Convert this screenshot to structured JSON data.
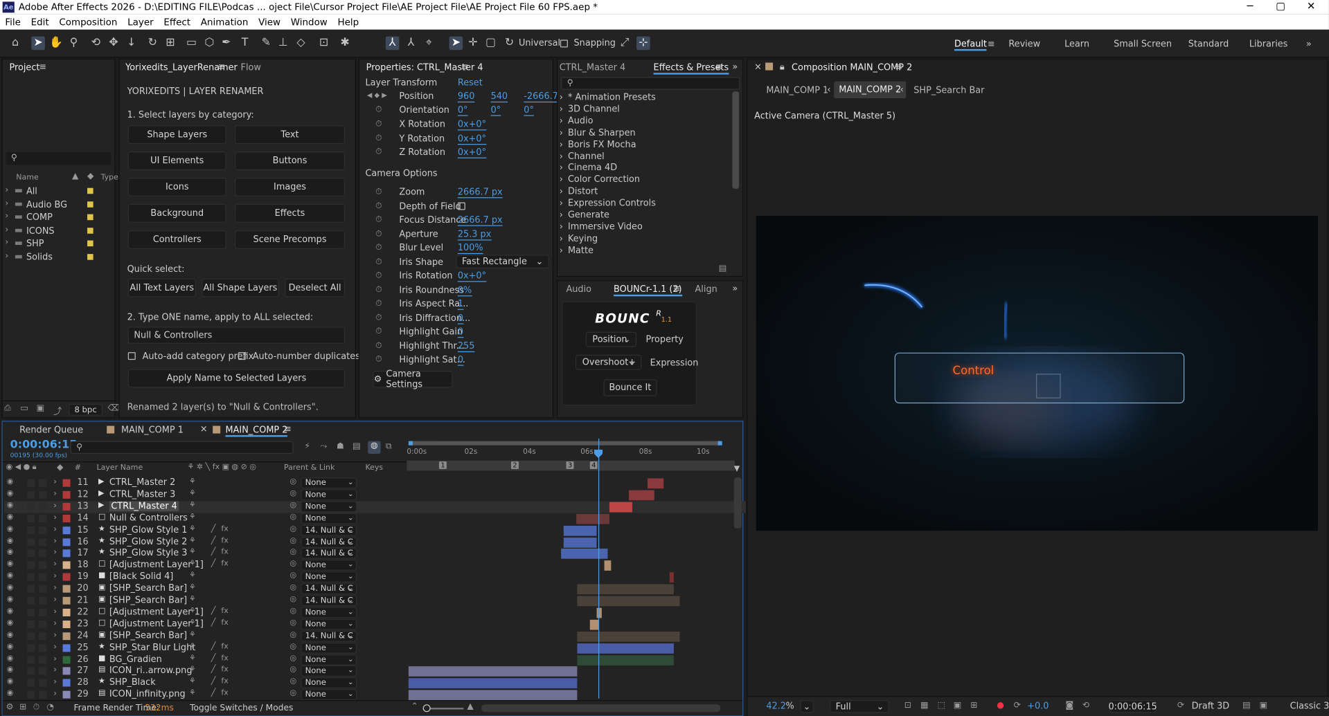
{
  "window": {
    "title": "Adobe After Effects 2026 - D:\\EDITING FILE\\Podcas ... oject File\\Cursor Project File\\AE Project File\\AE Project File 60 FPS.aep *",
    "app_badge": "Ae",
    "minimize": "─",
    "maximize": "▢",
    "close": "✕"
  },
  "menu": [
    "File",
    "Edit",
    "Composition",
    "Layer",
    "Effect",
    "Animation",
    "View",
    "Window",
    "Help"
  ],
  "toolbar": {
    "universal": "Universal",
    "snapping": "Snapping"
  },
  "workspaces": [
    "Default",
    "Review",
    "Learn",
    "Small Screen",
    "Standard",
    "Libraries"
  ],
  "project": {
    "tab": "Project",
    "columns": {
      "name": "Name",
      "type": "Type"
    },
    "items": [
      {
        "name": "All",
        "color": "#e0c54a"
      },
      {
        "name": "Audio BG",
        "color": "#e0c54a"
      },
      {
        "name": "COMP",
        "color": "#e0c54a"
      },
      {
        "name": "ICONS",
        "color": "#e0c54a"
      },
      {
        "name": "SHP",
        "color": "#e0c54a"
      },
      {
        "name": "Solids",
        "color": "#e0c54a"
      }
    ],
    "bpc": "8 bpc"
  },
  "renamer": {
    "tab": "Yorixedits_LayerRenamer",
    "tab2": "Flow",
    "heading": "YORIXEDITS  |  LAYER RENAMER",
    "step1": "1. Select layers by category:",
    "categories": [
      "Shape Layers",
      "Text",
      "UI Elements",
      "Buttons",
      "Icons",
      "Images",
      "Background",
      "Effects",
      "Controllers",
      "Scene Precomps"
    ],
    "quick": "Quick select:",
    "quick_buttons": [
      "All Text Layers",
      "All Shape Layers",
      "Deselect All"
    ],
    "step2": "2. Type ONE name, apply to ALL selected:",
    "name_value": "Null & Controllers",
    "opt1": "Auto-add category prefix",
    "opt2": "Auto-number duplicates",
    "apply": "Apply Name to Selected Layers",
    "status": "Renamed 2 layer(s) to \"Null & Controllers\"."
  },
  "properties": {
    "tab": "Properties: CTRL_Master 4",
    "layer_transform": "Layer Transform",
    "reset": "Reset",
    "position": {
      "label": "Position",
      "x": "960",
      "y": "540",
      "z": "-2666.7"
    },
    "orientation": {
      "label": "Orientation",
      "x": "0°",
      "y": "0°",
      "z": "0°"
    },
    "rotations": [
      {
        "label": "X Rotation",
        "value": "0x+0°"
      },
      {
        "label": "Y Rotation",
        "value": "0x+0°"
      },
      {
        "label": "Z Rotation",
        "value": "0x+0°"
      }
    ],
    "camera_options": "Camera Options",
    "camera": [
      {
        "label": "Zoom",
        "value": "2666.7 px"
      },
      {
        "label": "Depth of Field",
        "value": ""
      },
      {
        "label": "Focus Distance",
        "value": "2666.7 px"
      },
      {
        "label": "Aperture",
        "value": "25.3 px"
      },
      {
        "label": "Blur Level",
        "value": "100%"
      },
      {
        "label": "Iris Shape",
        "value": "Fast Rectangle"
      },
      {
        "label": "Iris Rotation",
        "value": "0x+0°"
      },
      {
        "label": "Iris Roundness",
        "value": "0%"
      },
      {
        "label": "Iris Aspect Ra...",
        "value": "1"
      },
      {
        "label": "Iris Diffraction...",
        "value": "0"
      },
      {
        "label": "Highlight Gain",
        "value": "0"
      },
      {
        "label": "Highlight Thr...",
        "value": "255"
      },
      {
        "label": "Highlight Sat...",
        "value": "0"
      }
    ],
    "settings_btn": "Camera Settings"
  },
  "effects": {
    "tab1": "CTRL_Master 4",
    "tab2": "Effects & Presets",
    "items": [
      "* Animation Presets",
      "3D Channel",
      "Audio",
      "Blur & Sharpen",
      "Boris FX Mocha",
      "Channel",
      "Cinema 4D",
      "Color Correction",
      "Distort",
      "Expression Controls",
      "Generate",
      "Immersive Video",
      "Keying",
      "Matte"
    ]
  },
  "bouncr": {
    "tab_audio": "Audio",
    "tab": "BOUNCr-1.1 (2)",
    "tab_align": "Align",
    "logo": "BOUNC",
    "logo_sup": "R",
    "logo_ver": "1.1",
    "property_value": "Position",
    "property_label": "Property",
    "expression_value": "Overshoot+",
    "expression_label": "Expression",
    "bounce": "Bounce It"
  },
  "composition": {
    "tab": "Composition MAIN_COMP 2",
    "crumbs": [
      "MAIN_COMP 1",
      "MAIN_COMP 2",
      "SHP_Search Bar"
    ],
    "camera_label": "Active Camera (CTRL_Master 5)",
    "control_text": "Control",
    "zoom": "42.2",
    "zoom_unit": "%",
    "quality": "Full",
    "exposure": "+0.0",
    "time": "0:00:06:15",
    "draft": "Draft 3D",
    "renderer": "Classic 3D"
  },
  "timeline": {
    "tabs": [
      "Render Queue",
      "MAIN_COMP 1",
      "MAIN_COMP 2"
    ],
    "timecode": "0:00:06:15",
    "frames": "00195 (30.00 fps)",
    "headers": {
      "num": "#",
      "name": "Layer Name",
      "parent": "Parent & Link",
      "keys": "Keys"
    },
    "ruler": [
      "0:00s",
      "02s",
      "04s",
      "06s",
      "08s",
      "10s"
    ],
    "markers": [
      "1",
      "2",
      "3",
      "4"
    ],
    "footer_left": "Frame Render Time:",
    "footer_time": "532ms",
    "footer_toggle": "Toggle Switches / Modes",
    "layers": [
      {
        "num": "11",
        "name": "CTRL_Master 2",
        "color": "#b03a3a",
        "icon": "cam",
        "parent": "None",
        "fx": false
      },
      {
        "num": "12",
        "name": "CTRL_Master 3",
        "color": "#b03a3a",
        "icon": "cam",
        "parent": "None",
        "fx": false
      },
      {
        "num": "13",
        "name": "CTRL_Master 4",
        "color": "#b03a3a",
        "icon": "cam",
        "parent": "None",
        "fx": false
      },
      {
        "num": "14",
        "name": "Null & Controllers",
        "color": "#b03a3a",
        "icon": "null",
        "parent": "None",
        "fx": false
      },
      {
        "num": "15",
        "name": "SHP_Glow Style 1",
        "color": "#5a7ad8",
        "icon": "star",
        "parent": "14. Null & C",
        "fx": true
      },
      {
        "num": "16",
        "name": "SHP_Glow Style 2",
        "color": "#5a7ad8",
        "icon": "star",
        "parent": "14. Null & C",
        "fx": true
      },
      {
        "num": "17",
        "name": "SHP_Glow Style 3",
        "color": "#5a7ad8",
        "icon": "star",
        "parent": "14. Null & C",
        "fx": true
      },
      {
        "num": "18",
        "name": "[Adjustment Layer 1]",
        "color": "#d8b08a",
        "icon": "adj",
        "parent": "None",
        "fx": true
      },
      {
        "num": "19",
        "name": "[Black Solid 4]",
        "color": "#b03a3a",
        "icon": "solid",
        "parent": "None",
        "fx": false
      },
      {
        "num": "20",
        "name": "[SHP_Search Bar]",
        "color": "#b89a78",
        "icon": "comp",
        "parent": "14. Null & C",
        "fx": false
      },
      {
        "num": "21",
        "name": "[SHP_Search Bar]",
        "color": "#b89a78",
        "icon": "comp",
        "parent": "14. Null & C",
        "fx": false
      },
      {
        "num": "22",
        "name": "[Adjustment Layer 1]",
        "color": "#d8b08a",
        "icon": "adj",
        "parent": "None",
        "fx": true
      },
      {
        "num": "23",
        "name": "[Adjustment Layer 1]",
        "color": "#d8b08a",
        "icon": "adj",
        "parent": "None",
        "fx": true
      },
      {
        "num": "24",
        "name": "[SHP_Search Bar]",
        "color": "#b89a78",
        "icon": "comp",
        "parent": "14. Null & C",
        "fx": false
      },
      {
        "num": "25",
        "name": "SHP_Star Blur Light",
        "color": "#5a7ad8",
        "icon": "star",
        "parent": "None",
        "fx": true
      },
      {
        "num": "26",
        "name": "BG_Gradien",
        "color": "#2e6a3a",
        "icon": "solid",
        "parent": "None",
        "fx": true
      },
      {
        "num": "27",
        "name": "ICON_ri..arrow.png",
        "color": "#8a8ab8",
        "icon": "file",
        "parent": "None",
        "fx": true
      },
      {
        "num": "28",
        "name": "SHP_Black",
        "color": "#5a7ad8",
        "icon": "star",
        "parent": "None",
        "fx": true
      },
      {
        "num": "29",
        "name": "ICON_infinity.png",
        "color": "#8a8ab8",
        "icon": "file",
        "parent": "None",
        "fx": true
      }
    ]
  }
}
